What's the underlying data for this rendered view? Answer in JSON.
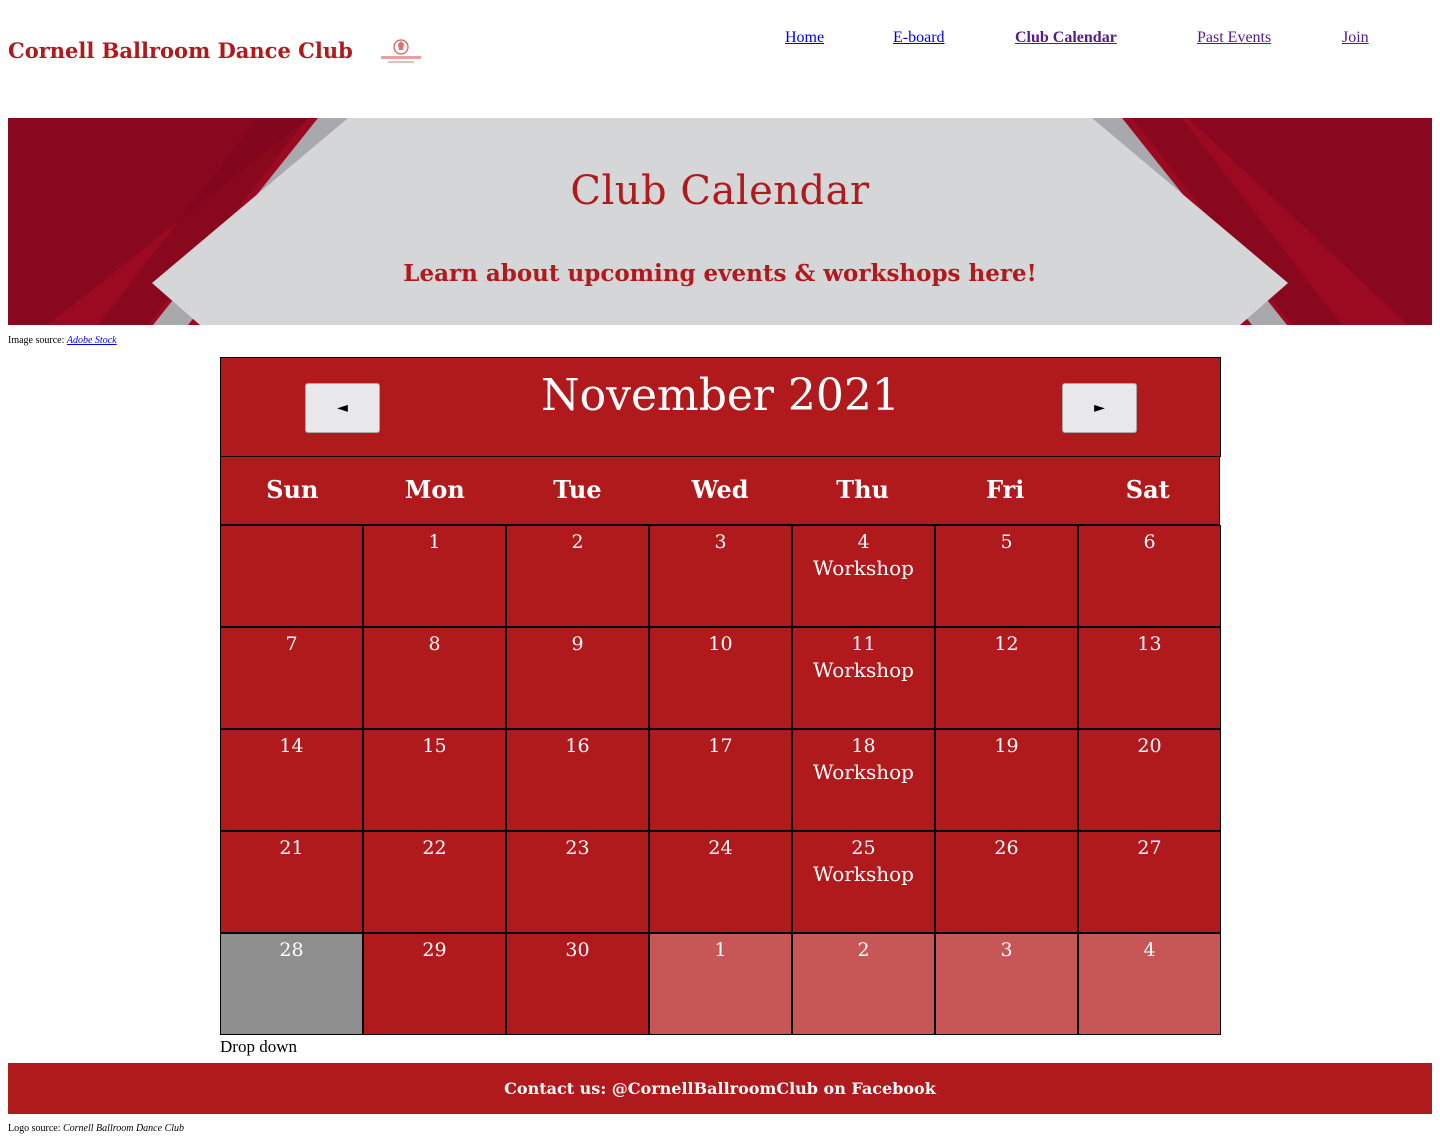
{
  "site": {
    "title": "Cornell Ballroom Dance Club"
  },
  "nav": {
    "items": [
      {
        "label": "Home"
      },
      {
        "label": "E-board"
      },
      {
        "label": "Club Calendar"
      },
      {
        "label": "Past Events"
      },
      {
        "label": "Join"
      }
    ]
  },
  "hero": {
    "title": "Club Calendar",
    "subtitle": "Learn about upcoming events & workshops here!"
  },
  "image_source": {
    "prefix": "Image source:",
    "link": "Adobe Stock"
  },
  "calendar": {
    "month": "November 2021",
    "prev_button": "◄",
    "next_button": "►",
    "weekdays": [
      "Sun",
      "Mon",
      "Tue",
      "Wed",
      "Thu",
      "Fri",
      "Sat"
    ],
    "cells": [
      {
        "day": "",
        "event": "",
        "state": "normal"
      },
      {
        "day": "1",
        "event": "",
        "state": "normal"
      },
      {
        "day": "2",
        "event": "",
        "state": "normal"
      },
      {
        "day": "3",
        "event": "",
        "state": "normal"
      },
      {
        "day": "4",
        "event": "Workshop",
        "state": "normal"
      },
      {
        "day": "5",
        "event": "",
        "state": "normal"
      },
      {
        "day": "6",
        "event": "",
        "state": "normal"
      },
      {
        "day": "7",
        "event": "",
        "state": "normal"
      },
      {
        "day": "8",
        "event": "",
        "state": "normal"
      },
      {
        "day": "9",
        "event": "",
        "state": "normal"
      },
      {
        "day": "10",
        "event": "",
        "state": "normal"
      },
      {
        "day": "11",
        "event": "Workshop",
        "state": "normal"
      },
      {
        "day": "12",
        "event": "",
        "state": "normal"
      },
      {
        "day": "13",
        "event": "",
        "state": "normal"
      },
      {
        "day": "14",
        "event": "",
        "state": "normal"
      },
      {
        "day": "15",
        "event": "",
        "state": "normal"
      },
      {
        "day": "16",
        "event": "",
        "state": "normal"
      },
      {
        "day": "17",
        "event": "",
        "state": "normal"
      },
      {
        "day": "18",
        "event": "Workshop",
        "state": "normal"
      },
      {
        "day": "19",
        "event": "",
        "state": "normal"
      },
      {
        "day": "20",
        "event": "",
        "state": "normal"
      },
      {
        "day": "21",
        "event": "",
        "state": "normal"
      },
      {
        "day": "22",
        "event": "",
        "state": "normal"
      },
      {
        "day": "23",
        "event": "",
        "state": "normal"
      },
      {
        "day": "24",
        "event": "",
        "state": "normal"
      },
      {
        "day": "25",
        "event": "Workshop",
        "state": "normal"
      },
      {
        "day": "26",
        "event": "",
        "state": "normal"
      },
      {
        "day": "27",
        "event": "",
        "state": "normal"
      },
      {
        "day": "28",
        "event": "",
        "state": "today"
      },
      {
        "day": "29",
        "event": "",
        "state": "normal"
      },
      {
        "day": "30",
        "event": "",
        "state": "normal"
      },
      {
        "day": "1",
        "event": "",
        "state": "out"
      },
      {
        "day": "2",
        "event": "",
        "state": "out"
      },
      {
        "day": "3",
        "event": "",
        "state": "out"
      },
      {
        "day": "4",
        "event": "",
        "state": "out"
      }
    ]
  },
  "dropdown": {
    "label": "Drop down"
  },
  "footer": {
    "contact": "Contact us: @CornellBallroomClub on Facebook"
  },
  "logo_source": {
    "prefix": "Logo source:",
    "name": "Cornell Ballroom Dance Club"
  },
  "colors": {
    "brand_red": "#b01a1d",
    "out_of_month": "#c75757",
    "today": "#8f8f8f",
    "hero_grey": "#d5d6d8"
  }
}
